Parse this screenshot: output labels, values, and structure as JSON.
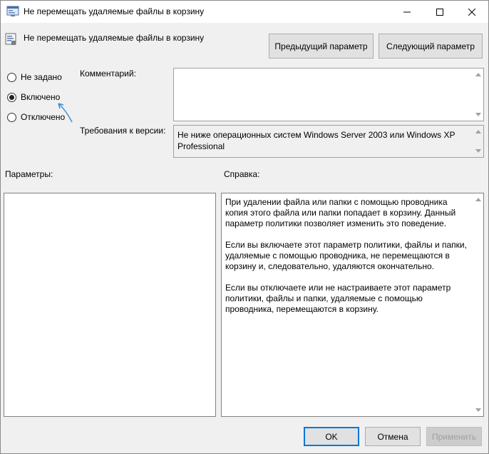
{
  "window": {
    "title": "Не перемещать удаляемые файлы в корзину"
  },
  "policy": {
    "name": "Не перемещать удаляемые файлы в корзину"
  },
  "nav_buttons": {
    "prev_label": "Предыдущий параметр",
    "next_label": "Следующий параметр"
  },
  "state": {
    "options": [
      {
        "label": "Не задано",
        "selected": false
      },
      {
        "label": "Включено",
        "selected": true
      },
      {
        "label": "Отключено",
        "selected": false
      }
    ]
  },
  "comment": {
    "label": "Комментарий:",
    "value": ""
  },
  "version": {
    "label": "Требования к версии:",
    "value": "Не ниже операционных систем Windows Server 2003 или Windows XP Professional"
  },
  "options_panel": {
    "label": "Параметры:"
  },
  "help_panel": {
    "label": "Справка:",
    "paragraphs": [
      "При удалении файла или папки с помощью проводника копия этого файла или папки попадает в корзину. Данный параметр политики позволяет изменить это поведение.",
      "Если вы включаете этот параметр политики, файлы и папки, удаляемые с помощью проводника, не перемещаются в корзину и, следовательно, удаляются окончательно.",
      "Если вы отключаете или не настраиваете этот параметр политики, файлы и папки, удаляемые с помощью проводника, перемещаются в корзину."
    ]
  },
  "footer": {
    "ok_label": "OK",
    "cancel_label": "Отмена",
    "apply_label": "Применить"
  },
  "colors": {
    "accent": "#0078d7",
    "annotation_arrow": "#3a8fd6"
  }
}
